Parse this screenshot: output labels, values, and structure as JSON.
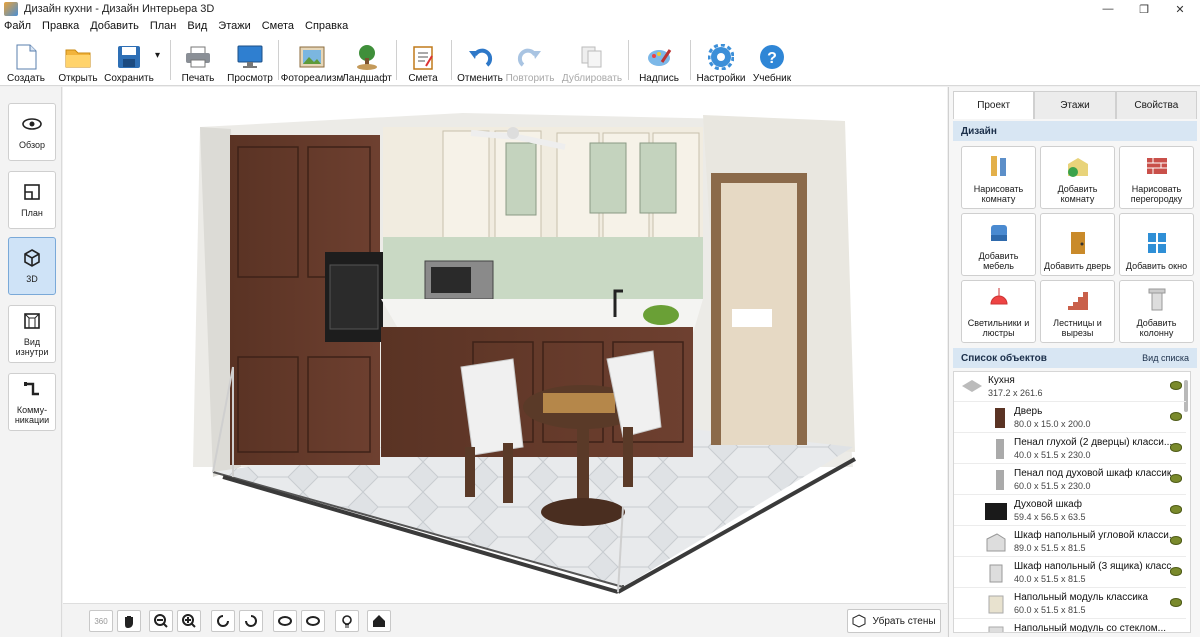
{
  "window": {
    "title": "Дизайн кухни - Дизайн Интерьера 3D",
    "min": "—",
    "max": "❐",
    "close": "✕"
  },
  "menu": [
    "Файл",
    "Правка",
    "Добавить",
    "План",
    "Вид",
    "Этажи",
    "Смета",
    "Справка"
  ],
  "toolbar": {
    "create": "Создать",
    "open": "Открыть",
    "save": "Сохранить",
    "save_arrow": "▾",
    "print": "Печать",
    "preview": "Просмотр",
    "photoreal": "Фотореализм",
    "landscape": "Ландшафт",
    "estimate": "Смета",
    "undo": "Отменить",
    "redo": "Повторить",
    "duplicate": "Дублировать",
    "label": "Надпись",
    "settings": "Настройки",
    "tutorial": "Учебник"
  },
  "left": {
    "overview": "Обзор",
    "plan": "План",
    "view3d": "3D",
    "inside": "Вид изнутри",
    "comm": "Комму-никации"
  },
  "bottom": {
    "btn360": "360",
    "remove_walls": "Убрать стены"
  },
  "right": {
    "tabs": [
      "Проект",
      "Этажи",
      "Свойства"
    ],
    "design_header": "Дизайн",
    "design": [
      {
        "label": "Нарисовать комнату",
        "icon": "draw-room-icon"
      },
      {
        "label": "Добавить комнату",
        "icon": "add-room-icon"
      },
      {
        "label": "Нарисовать перегородку",
        "icon": "partition-icon"
      },
      {
        "label": "Добавить мебель",
        "icon": "furniture-icon"
      },
      {
        "label": "Добавить дверь",
        "icon": "door-icon"
      },
      {
        "label": "Добавить окно",
        "icon": "window-icon"
      },
      {
        "label": "Светильники и люстры",
        "icon": "lamp-icon"
      },
      {
        "label": "Лестницы и вырезы",
        "icon": "stairs-icon"
      },
      {
        "label": "Добавить колонну",
        "icon": "column-icon"
      }
    ],
    "objects_header": "Список объектов",
    "view_list": "Вид списка",
    "objects": [
      {
        "name": "Кухня",
        "dim": "317.2 x 261.6"
      },
      {
        "name": "Дверь",
        "dim": "80.0 x 15.0 x 200.0"
      },
      {
        "name": "Пенал глухой (2 дверцы) класси...",
        "dim": "40.0 x 51.5 x 230.0"
      },
      {
        "name": "Пенал под духовой шкаф классик...",
        "dim": "60.0 x 51.5 x 230.0"
      },
      {
        "name": "Духовой шкаф",
        "dim": "59.4 x 56.5 x 63.5"
      },
      {
        "name": "Шкаф напольный угловой класси...",
        "dim": "89.0 x 51.5 x 81.5"
      },
      {
        "name": "Шкаф напольный (3 ящика) класс...",
        "dim": "40.0 x 51.5 x 81.5"
      },
      {
        "name": "Напольный модуль классика",
        "dim": "60.0 x 51.5 x 81.5"
      },
      {
        "name": "Напольный модуль со стеклом...",
        "dim": ""
      }
    ]
  }
}
